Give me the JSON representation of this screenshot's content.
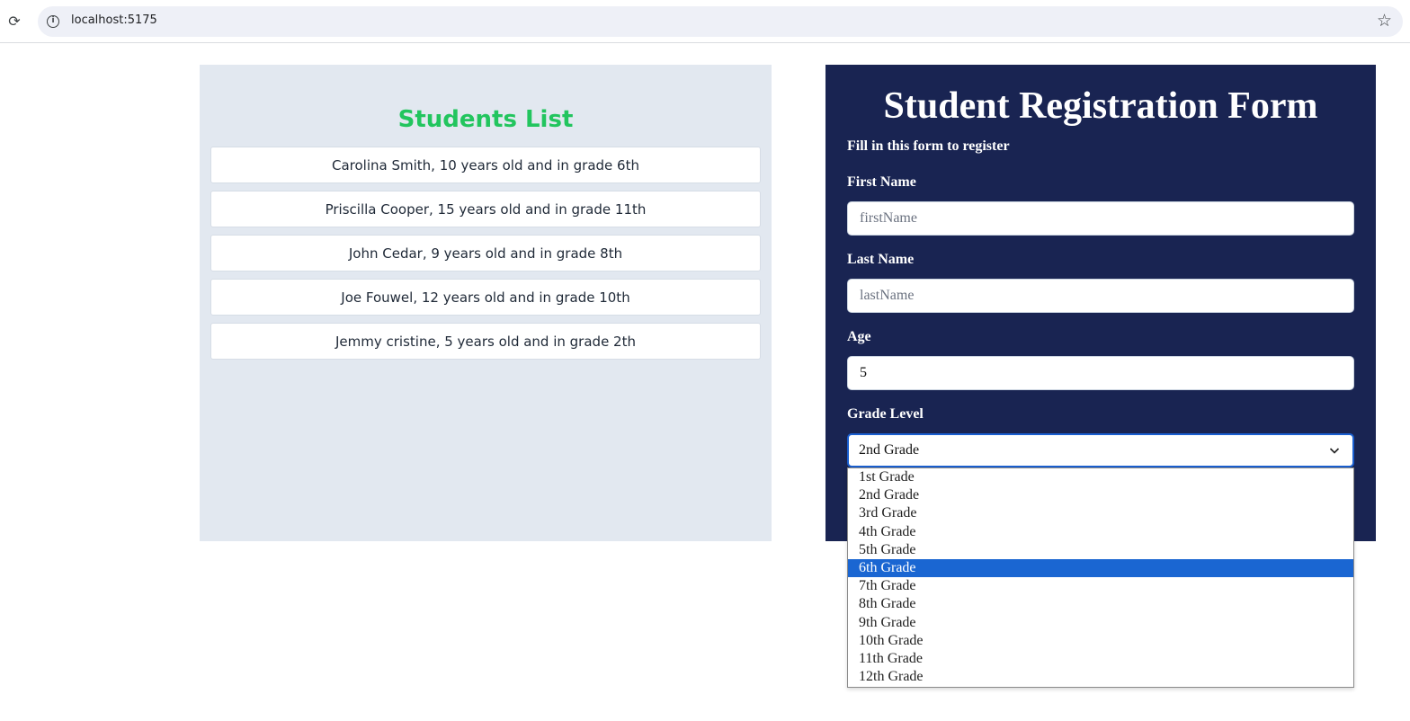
{
  "browser": {
    "url": "localhost:5175"
  },
  "students": {
    "title": "Students List",
    "items": [
      "Carolina Smith, 10 years old and in grade 6th",
      "Priscilla Cooper, 15 years old and in grade 11th",
      "John Cedar, 9 years old and in grade 8th",
      "Joe Fouwel, 12 years old and in grade 10th",
      "Jemmy cristine, 5 years old and in grade 2th"
    ]
  },
  "form": {
    "title": "Student Registration Form",
    "subtitle": "Fill in this form to register",
    "first_name": {
      "label": "First Name",
      "placeholder": "firstName",
      "value": ""
    },
    "last_name": {
      "label": "Last Name",
      "placeholder": "lastName",
      "value": ""
    },
    "age": {
      "label": "Age",
      "value": "5"
    },
    "grade": {
      "label": "Grade Level",
      "selected": "2nd Grade",
      "highlighted": "6th Grade",
      "options": [
        "1st Grade",
        "2nd Grade",
        "3rd Grade",
        "4th Grade",
        "5th Grade",
        "6th Grade",
        "7th Grade",
        "8th Grade",
        "9th Grade",
        "10th Grade",
        "11th Grade",
        "12th Grade"
      ]
    }
  },
  "colors": {
    "students_title": "#22c55e",
    "students_panel_bg": "#e2e8f0",
    "form_panel_bg": "#192452",
    "dropdown_highlight": "#1a66d2"
  },
  "icons": {
    "reload": "reload-icon",
    "site_info": "info-icon",
    "bookmark": "star-icon",
    "select_arrow": "chevron-down-icon"
  }
}
